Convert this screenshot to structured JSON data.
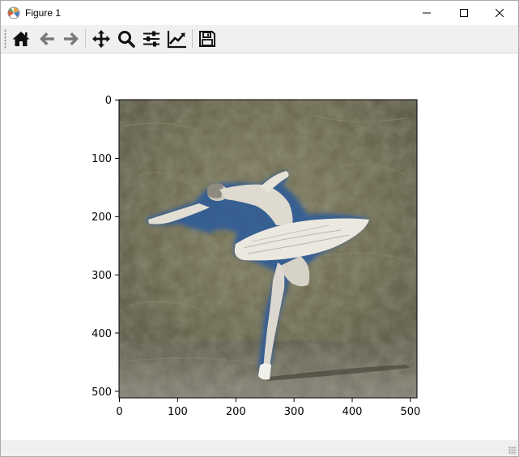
{
  "window": {
    "title": "Figure 1",
    "icon": "matplotlib-icon",
    "controls": [
      "minimize-icon",
      "maximize-icon",
      "close-icon"
    ]
  },
  "toolbar": {
    "tools": [
      {
        "name": "home",
        "icon": "home-icon"
      },
      {
        "name": "back",
        "icon": "arrow-left-icon"
      },
      {
        "name": "forward",
        "icon": "arrow-right-icon"
      },
      {
        "name": "pan",
        "icon": "move-icon"
      },
      {
        "name": "zoom",
        "icon": "magnifier-icon"
      },
      {
        "name": "configure-subplots",
        "icon": "sliders-icon"
      },
      {
        "name": "edit-axis",
        "icon": "line-chart-icon"
      },
      {
        "name": "save",
        "icon": "floppy-disk-icon"
      }
    ]
  },
  "axes": {
    "y_ticks": [
      "0",
      "100",
      "200",
      "300",
      "400",
      "500"
    ],
    "x_ticks": [
      "0",
      "100",
      "200",
      "300",
      "400",
      "500"
    ],
    "image_extent": {
      "x": [
        0,
        512
      ],
      "y": [
        512,
        0
      ]
    },
    "image_subject": "ballerina in white tutu, stylized painting",
    "colors": {
      "background": "#6a6a4a",
      "figure": "#dcd8cf",
      "halo": "#2a5a9a"
    }
  },
  "statusbar": {
    "text": ""
  }
}
